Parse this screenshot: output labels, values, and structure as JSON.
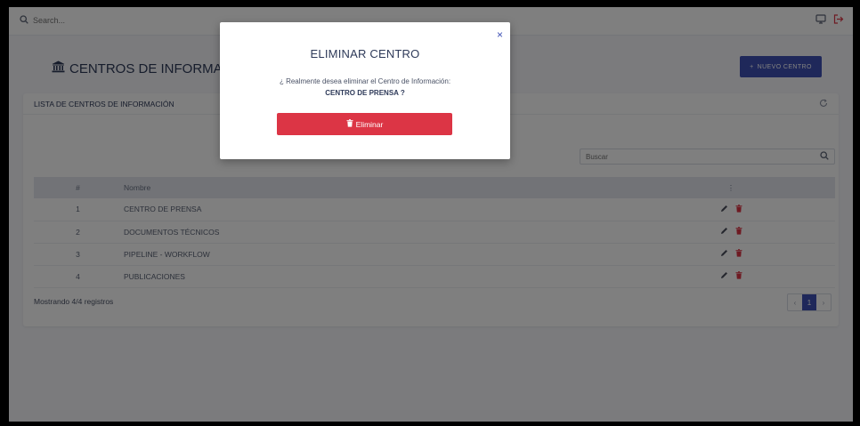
{
  "topbar": {
    "search_placeholder": "Search...",
    "icons": [
      "search-icon",
      "monitor-icon",
      "logout-icon"
    ]
  },
  "header": {
    "title": "CENTROS DE INFORMACIÓN",
    "title_icon": "institution-icon",
    "new_button_label": "NUEVO CENTRO",
    "new_button_icon": "plus-icon"
  },
  "card": {
    "title": "LISTA DE CENTROS DE INFORMACIÓN",
    "search_placeholder": "Buscar",
    "columns": [
      "#",
      "Nombre",
      "⋮"
    ],
    "rows": [
      {
        "num": "1",
        "name": "CENTRO DE PRENSA"
      },
      {
        "num": "2",
        "name": "DOCUMENTOS TÉCNICOS"
      },
      {
        "num": "3",
        "name": "PIPELINE - WORKFLOW"
      },
      {
        "num": "4",
        "name": "PUBLICACIONES"
      }
    ],
    "footer_text": "Mostrando 4/4 registros",
    "pagination": {
      "prev": "‹",
      "current": "1",
      "next": "›"
    }
  },
  "modal": {
    "title": "ELIMINAR CENTRO",
    "message": "¿ Realmente desea eliminar el Centro de Información:",
    "target": "CENTRO DE PRENSA ?",
    "delete_button_label": "Eliminar",
    "close_label": "×"
  },
  "colors": {
    "primary": "#3f51b5",
    "danger": "#dc3545",
    "edit_icon": "#4a4f5c"
  }
}
